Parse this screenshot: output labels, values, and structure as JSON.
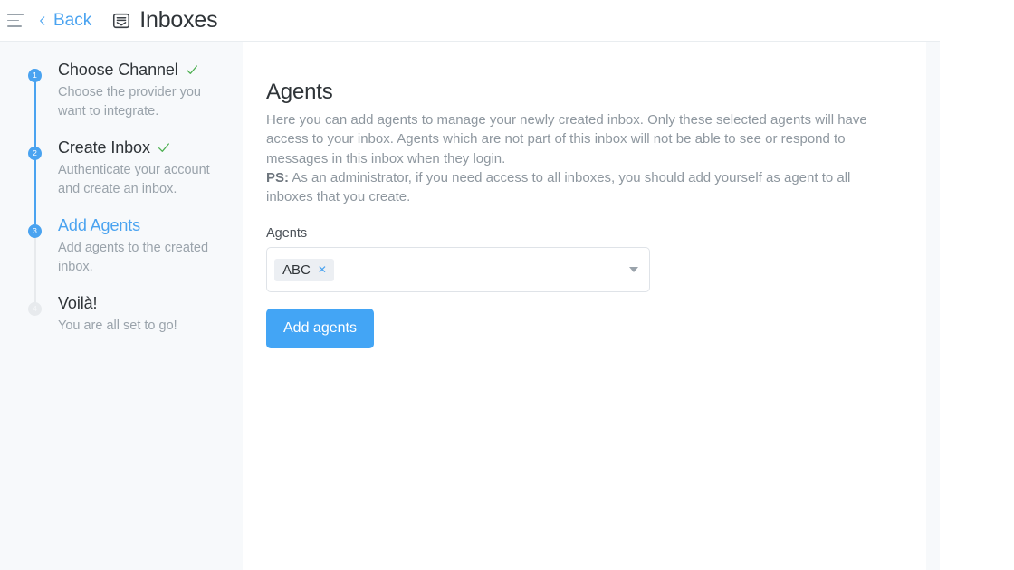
{
  "header": {
    "menu_icon": "hamburger-icon",
    "back_label": "Back",
    "back_icon": "chevron-left-icon",
    "title_icon": "inbox-icon",
    "title": "Inboxes",
    "accent_color": "#4aa3f0"
  },
  "wizard": {
    "steps": [
      {
        "number": "1",
        "title": "Choose Channel",
        "description": "Choose the provider you want to integrate.",
        "state": "completed",
        "check_icon": "check-icon"
      },
      {
        "number": "2",
        "title": "Create Inbox",
        "description": "Authenticate your account and create an inbox.",
        "state": "completed",
        "check_icon": "check-icon"
      },
      {
        "number": "3",
        "title": "Add Agents",
        "description": "Add agents to the created inbox.",
        "state": "current",
        "check_icon": ""
      },
      {
        "number": "4",
        "title": "Voilà!",
        "description": "You are all set to go!",
        "state": "inactive",
        "check_icon": ""
      }
    ],
    "completed_color": "#4aa3f0",
    "inactive_color": "#e7eaed",
    "check_color": "#4caf50"
  },
  "content": {
    "title": "Agents",
    "paragraph": "Here you can add agents to manage your newly created inbox. Only these selected agents will have access to your inbox. Agents which are not part of this inbox will not be able to see or respond to messages in this inbox when they login.",
    "ps_label": "PS:",
    "ps_text": " As an administrator, if you need access to all inboxes, you should add yourself as agent to all inboxes that you create.",
    "form": {
      "field_label": "Agents",
      "selected_agents": [
        "ABC"
      ],
      "chip_remove_icon": "close-icon",
      "dropdown_icon": "chevron-down-icon",
      "placeholder": "",
      "submit_label": "Add agents",
      "submit_color": "#43a5f5"
    }
  }
}
